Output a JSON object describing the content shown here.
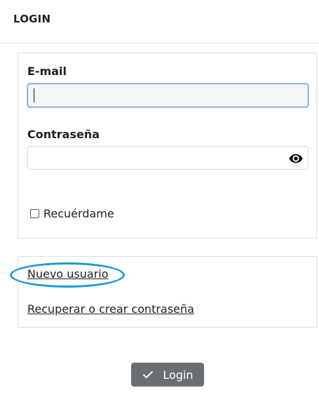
{
  "header": {
    "title": "LOGIN"
  },
  "form": {
    "email_label": "E-mail",
    "email_value": "",
    "password_label": "Contraseña",
    "password_value": "",
    "remember_label": "Recuérdame",
    "remember_checked": false
  },
  "links": {
    "new_user": "Nuevo usuario",
    "recover": "Recuperar o crear contraseña"
  },
  "actions": {
    "login_label": "Login"
  },
  "icons": {
    "password_toggle": "eye-icon",
    "login": "check-icon"
  },
  "colors": {
    "highlight": "#1a9ad6",
    "button_bg": "#6b6e73",
    "focus_border": "#4b86c5"
  }
}
